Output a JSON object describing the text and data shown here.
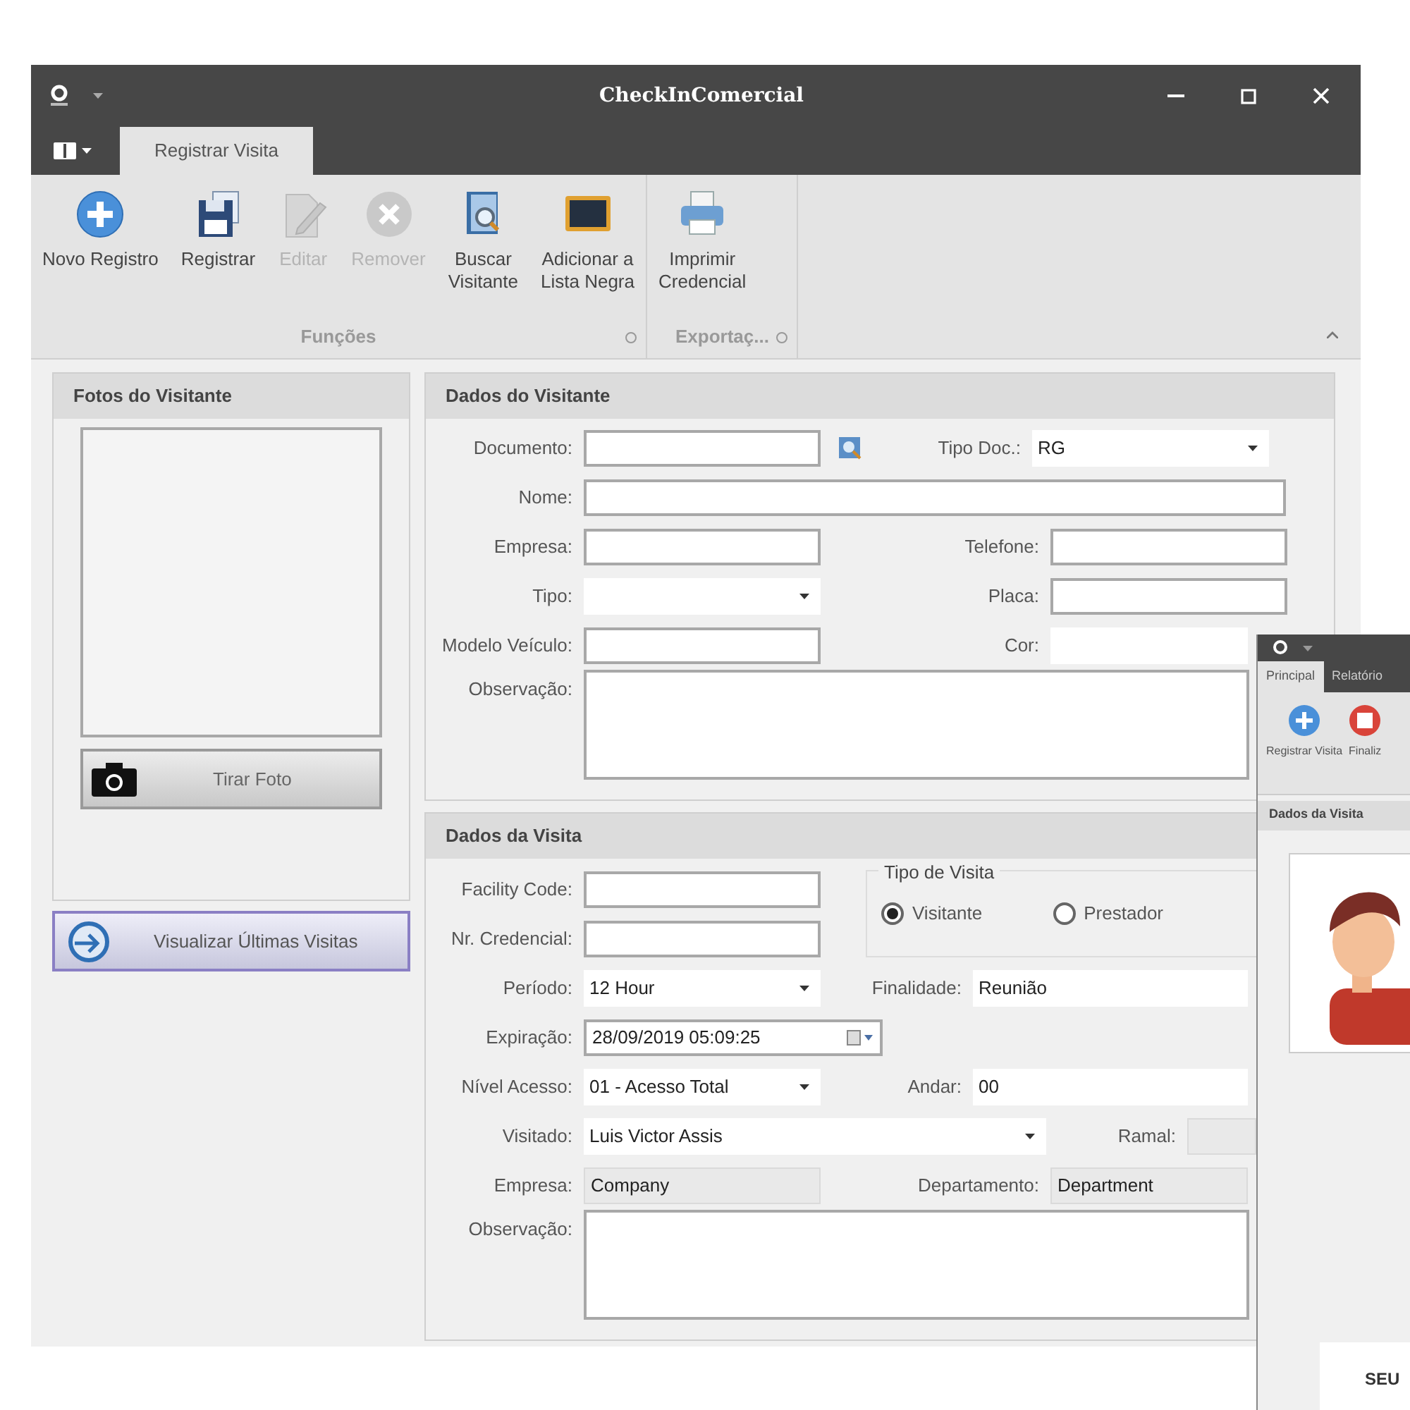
{
  "window": {
    "title": "CheckInComercial"
  },
  "tabs": [
    {
      "label": "Registrar Visita",
      "selected": true
    }
  ],
  "ribbon": {
    "groups": [
      {
        "label": "Funções",
        "buttons": [
          {
            "lines": [
              "Novo Registro"
            ],
            "disabled": false
          },
          {
            "lines": [
              "Registrar"
            ],
            "disabled": false
          },
          {
            "lines": [
              "Editar"
            ],
            "disabled": true
          },
          {
            "lines": [
              "Remover"
            ],
            "disabled": true
          },
          {
            "lines": [
              "Buscar",
              "Visitante"
            ],
            "disabled": false
          },
          {
            "lines": [
              "Adicionar a",
              "Lista Negra"
            ],
            "disabled": false
          }
        ]
      },
      {
        "label": "Exportaç...",
        "buttons": [
          {
            "lines": [
              "Imprimir",
              "Credencial"
            ],
            "disabled": false
          }
        ]
      }
    ]
  },
  "photos": {
    "title": "Fotos do Visitante",
    "capture_button": "Tirar Foto",
    "history_button": "Visualizar Últimas Visitas"
  },
  "visitor": {
    "title": "Dados do Visitante",
    "rows": [
      [
        {
          "label": "Documento:",
          "kind": "search"
        },
        {
          "label": "Tipo Doc.:",
          "kind": "combo",
          "value": "RG"
        }
      ],
      [
        {
          "label": "Nome:",
          "kind": "full"
        }
      ],
      [
        {
          "label": "Empresa:",
          "kind": "text"
        },
        {
          "label": "Telefone:",
          "kind": "text"
        }
      ],
      [
        {
          "label": "Tipo:",
          "kind": "combo"
        },
        {
          "label": "Placa:",
          "kind": "text"
        }
      ],
      [
        {
          "label": "Modelo Veículo:",
          "kind": "text"
        },
        {
          "label": "Cor:",
          "kind": "plain"
        }
      ],
      [
        {
          "label": "Observação:",
          "kind": "memo"
        }
      ]
    ]
  },
  "visit": {
    "title": "Dados da Visita",
    "visit_type": {
      "title": "Tipo de Visita",
      "options": [
        {
          "label": "Visitante",
          "selected": true
        },
        {
          "label": "Prestador",
          "selected": false
        }
      ]
    },
    "top_rows": [
      [
        {
          "label": "Facility Code:",
          "kind": "text"
        }
      ],
      [
        {
          "label": "Nr. Credencial:",
          "kind": "text"
        }
      ]
    ],
    "rows": [
      [
        {
          "label": "Período:",
          "kind": "combo",
          "value": "12 Hour"
        },
        {
          "label": "Finalidade:",
          "kind": "plain",
          "value": "Reunião"
        }
      ],
      [
        {
          "label": "Expiração:",
          "kind": "date",
          "value": "28/09/2019 05:09:25"
        }
      ],
      [
        {
          "label": "Nível Acesso:",
          "kind": "combo",
          "value": "01 - Acesso Total"
        },
        {
          "label": "Andar:",
          "kind": "plain",
          "value": "00"
        }
      ],
      [
        {
          "label": "Visitado:",
          "kind": "wide",
          "value": "Luis Victor Assis"
        },
        {
          "label": "Ramal:",
          "kind": "readonly"
        }
      ],
      [
        {
          "label": "Empresa:",
          "kind": "readonly",
          "value": "Company"
        },
        {
          "label": "Departamento:",
          "kind": "readonly",
          "value": "Department"
        }
      ],
      [
        {
          "label": "Observação:",
          "kind": "memo"
        }
      ]
    ]
  },
  "second_window": {
    "tabs": [
      {
        "label": "Principal",
        "selected": true
      },
      {
        "label": "Relatório",
        "selected": false
      }
    ],
    "buttons": [
      {
        "label": "Registrar Visita"
      },
      {
        "label": "Finaliz"
      }
    ],
    "section": "Dados da Visita",
    "caption": "SEU"
  }
}
